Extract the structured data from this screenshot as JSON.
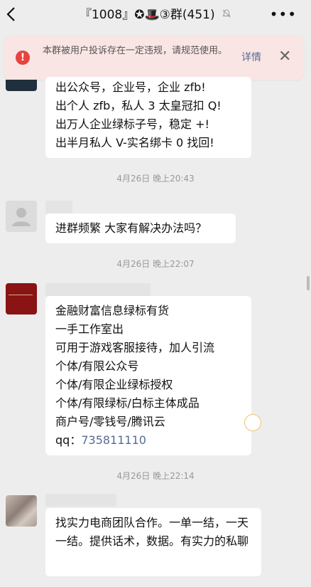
{
  "header": {
    "back_icon": "back-chevron-icon",
    "title": "『1008』✪🎩③群(451)",
    "muted_icon": "bell-muted-icon",
    "more_label": "•••"
  },
  "notice": {
    "warning_icon": "warning-circle-icon",
    "text": "本群被用户投诉存在一定违规，请规范使用。",
    "detail_label": "详情",
    "close_label": "✕"
  },
  "messages": [
    {
      "lines": [
        "出公众号，企业号，企业 zfb!",
        "出个人 zfb，私人 3 太皇冠扣 Q!",
        "出万人企业绿标子号，稳定 +!",
        "出半月私人 V-实名绑卡 0 找回!"
      ]
    },
    {
      "time": "4月26日 晚上20:43",
      "text": "进群频繁 大家有解决办法吗？"
    },
    {
      "time": "4月26日 晚上22:07",
      "lines": [
        "金融财富信息绿标有货",
        "一手工作室出",
        "可用于游戏客服接待，加人引流",
        "个体/有限公众号",
        "个体/有限企业绿标授权",
        "个体/有限绿标/白标主体成品",
        "商户号/零钱号/腾讯云"
      ],
      "qq_prefix": "qq：",
      "qq_number": "735811110"
    },
    {
      "time": "4月26日 晚上22:14",
      "text": "找实力电商团队合作。一单一结，一天一结。提供话术，数据。有实力的私聊"
    }
  ],
  "colors": {
    "background": "#ededed",
    "bubble": "#ffffff",
    "notice_bg": "#f9e5e4",
    "warning": "#e64340",
    "link": "#576b95"
  }
}
